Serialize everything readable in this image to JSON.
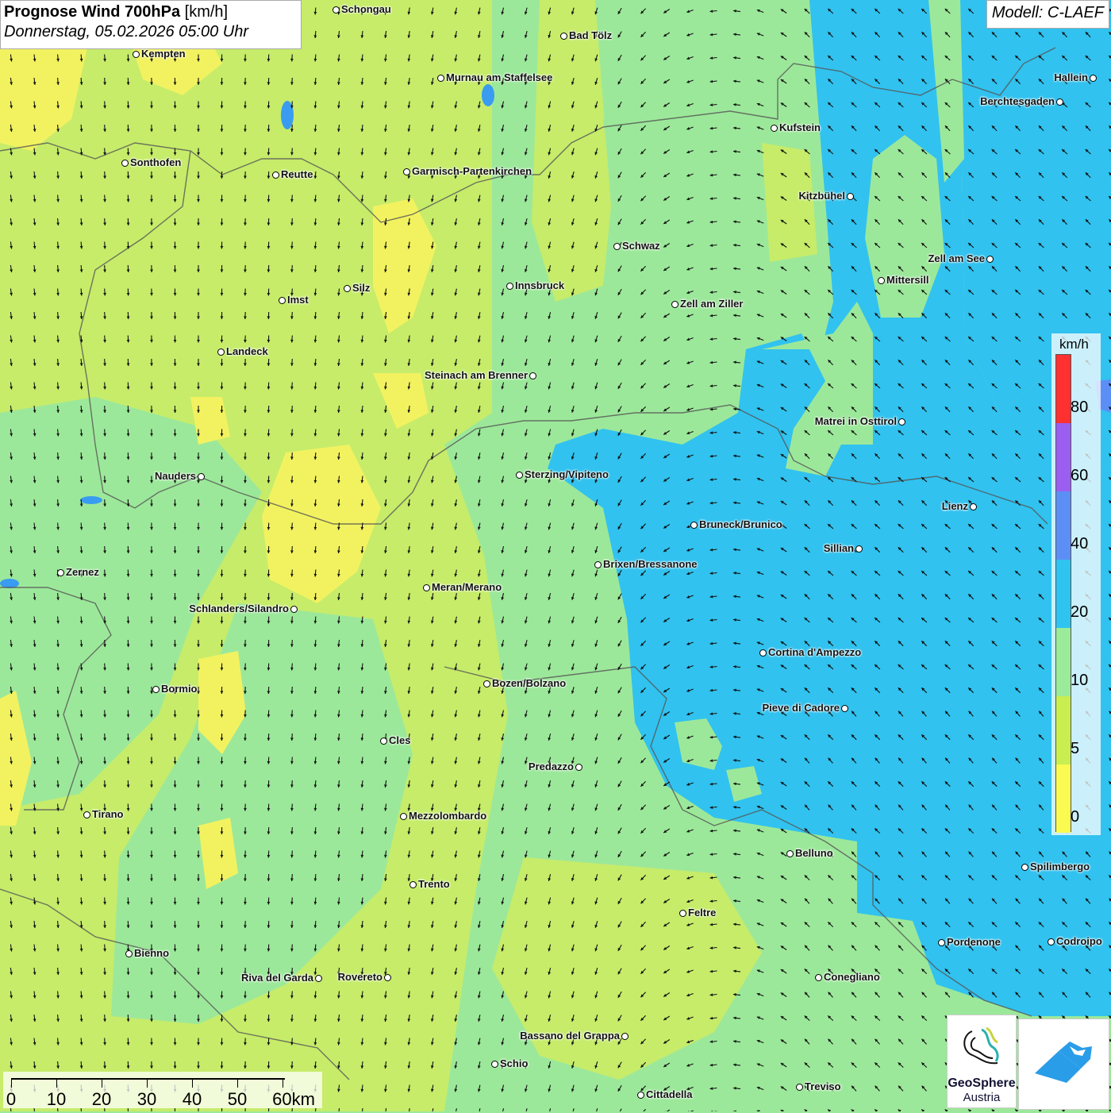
{
  "title": {
    "main": "Prognose Wind 700hPa",
    "unit": "[km/h]",
    "datetime": "Donnerstag, 05.02.2026 05:00 Uhr"
  },
  "model": "Modell: C-LAEF",
  "legend": {
    "unit": "km/h",
    "classes": [
      {
        "label": "80",
        "color": "#ff3030"
      },
      {
        "label": "60",
        "color": "#9a5ff0"
      },
      {
        "label": "40",
        "color": "#5c8ff5"
      },
      {
        "label": "20",
        "color": "#2ec4f0"
      },
      {
        "label": "10",
        "color": "#9aeb9a"
      },
      {
        "label": "5",
        "color": "#c8ee50"
      },
      {
        "label": "0",
        "color": "#fafa50"
      }
    ]
  },
  "scale": {
    "labels": [
      "0",
      "10",
      "20",
      "30",
      "40",
      "50",
      "60km"
    ]
  },
  "logos": {
    "geosphere_line1": "GeoSphere",
    "geosphere_line2": "Austria"
  },
  "cities": [
    {
      "name": "Schongau",
      "side": "r"
    },
    {
      "name": "Bad Tölz",
      "side": "r"
    },
    {
      "name": "Kempten",
      "side": "r"
    },
    {
      "name": "Murnau am Staffelsee",
      "side": "r"
    },
    {
      "name": "Hallein",
      "side": "l"
    },
    {
      "name": "Berchtesgaden",
      "side": "l"
    },
    {
      "name": "Kufstein",
      "side": "r"
    },
    {
      "name": "Sonthofen",
      "side": "r"
    },
    {
      "name": "Reutte",
      "side": "r"
    },
    {
      "name": "Garmisch-Partenkirchen",
      "side": "r"
    },
    {
      "name": "Kitzbühel",
      "side": "l"
    },
    {
      "name": "Schwaz",
      "side": "r"
    },
    {
      "name": "Zell am See",
      "side": "l"
    },
    {
      "name": "Innsbruck",
      "side": "r"
    },
    {
      "name": "Mittersill",
      "side": "r"
    },
    {
      "name": "Imst",
      "side": "r"
    },
    {
      "name": "Silz",
      "side": "r"
    },
    {
      "name": "Zell am Ziller",
      "side": "r"
    },
    {
      "name": "Landeck",
      "side": "r"
    },
    {
      "name": "Steinach am Brenner",
      "side": "l"
    },
    {
      "name": "Matrei in Osttirol",
      "side": "l"
    },
    {
      "name": "Nauders",
      "side": "l"
    },
    {
      "name": "Sterzing/Vipiteno",
      "side": "r"
    },
    {
      "name": "Lienz",
      "side": "l"
    },
    {
      "name": "Bruneck/Brunico",
      "side": "r"
    },
    {
      "name": "Sillian",
      "side": "l"
    },
    {
      "name": "Zernez",
      "side": "r"
    },
    {
      "name": "Brixen/Bressanone",
      "side": "r"
    },
    {
      "name": "Meran/Merano",
      "side": "r"
    },
    {
      "name": "Schlanders/Silandro",
      "side": "l"
    },
    {
      "name": "Cortina d'Ampezzo",
      "side": "r"
    },
    {
      "name": "Bozen/Bolzano",
      "side": "r"
    },
    {
      "name": "Bormio",
      "side": "r"
    },
    {
      "name": "Pieve di Cadore",
      "side": "l"
    },
    {
      "name": "Cles",
      "side": "r"
    },
    {
      "name": "Predazzo",
      "side": "l"
    },
    {
      "name": "Tirano",
      "side": "r"
    },
    {
      "name": "Mezzolombardo",
      "side": "r"
    },
    {
      "name": "Belluno",
      "side": "r"
    },
    {
      "name": "Spilimbergo",
      "side": "r"
    },
    {
      "name": "Trento",
      "side": "r"
    },
    {
      "name": "Feltre",
      "side": "r"
    },
    {
      "name": "Pordenone",
      "side": "r"
    },
    {
      "name": "Codroipo",
      "side": "r"
    },
    {
      "name": "Bienno",
      "side": "r"
    },
    {
      "name": "Riva del Garda",
      "side": "l"
    },
    {
      "name": "Rovereto",
      "side": "l"
    },
    {
      "name": "Conegliano",
      "side": "r"
    },
    {
      "name": "Bassano del Grappa",
      "side": "l"
    },
    {
      "name": "Schio",
      "side": "r"
    },
    {
      "name": "Treviso",
      "side": "r"
    },
    {
      "name": "Cittadella",
      "side": "r"
    }
  ]
}
